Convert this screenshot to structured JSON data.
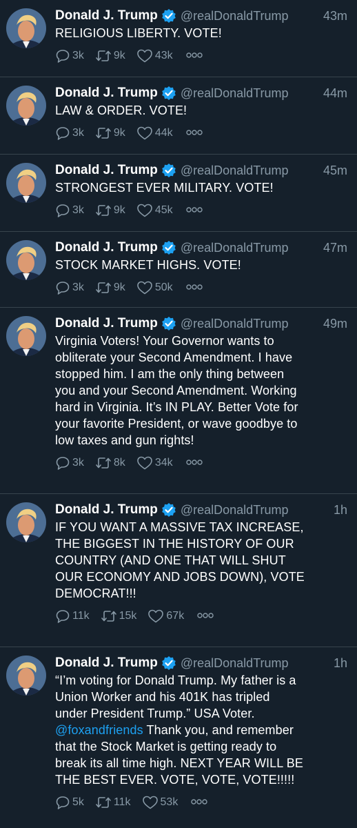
{
  "user": {
    "name": "Donald J. Trump",
    "handle": "@realDonaldTrump"
  },
  "colors": {
    "background": "#15202b",
    "secondary_text": "#8899a6",
    "link": "#1da1f2",
    "verified": "#1da1f2"
  },
  "icons": {
    "reply": "reply-icon",
    "retweet": "retweet-icon",
    "like": "heart-icon",
    "more": "more-icon",
    "verified": "verified-badge-icon"
  },
  "tweets": [
    {
      "time": "43m",
      "text": "RELIGIOUS LIBERTY. VOTE!",
      "replies": "3k",
      "retweets": "9k",
      "likes": "43k"
    },
    {
      "time": "44m",
      "text": "LAW & ORDER. VOTE!",
      "replies": "3k",
      "retweets": "9k",
      "likes": "44k"
    },
    {
      "time": "45m",
      "text": "STRONGEST EVER MILITARY. VOTE!",
      "replies": "3k",
      "retweets": "9k",
      "likes": "45k"
    },
    {
      "time": "47m",
      "text": "STOCK MARKET HIGHS. VOTE!",
      "replies": "3k",
      "retweets": "9k",
      "likes": "50k"
    },
    {
      "time": "49m",
      "text": "Virginia Voters! Your Governor wants to\nobliterate your Second Amendment. I have\nstopped him. I am the only thing between\nyou and your Second Amendment. Working\nhard in Virginia. It’s IN PLAY. Better Vote for\nyour favorite President, or wave goodbye to\nlow taxes and gun rights!",
      "replies": "3k",
      "retweets": "8k",
      "likes": "34k"
    },
    {
      "time": "1h",
      "text": "IF YOU WANT A MASSIVE TAX INCREASE,\nTHE BIGGEST IN THE HISTORY OF OUR\nCOUNTRY (AND ONE THAT WILL SHUT\nOUR ECONOMY AND JOBS DOWN), VOTE\nDEMOCRAT!!!",
      "replies": "11k",
      "retweets": "15k",
      "likes": "67k"
    },
    {
      "time": "1h",
      "text_before": "“I’m voting for Donald Trump. My father is a\nUnion Worker and his 401K has tripled\nunder President Trump.” USA Voter.\n",
      "mention": "@foxandfriends",
      "text_after": "  Thank you, and remember\nthat the Stock Market is getting ready to\nbreak its all time high. NEXT YEAR WILL BE\nTHE BEST EVER. VOTE, VOTE, VOTE!!!!!",
      "replies": "5k",
      "retweets": "11k",
      "likes": "53k"
    }
  ]
}
